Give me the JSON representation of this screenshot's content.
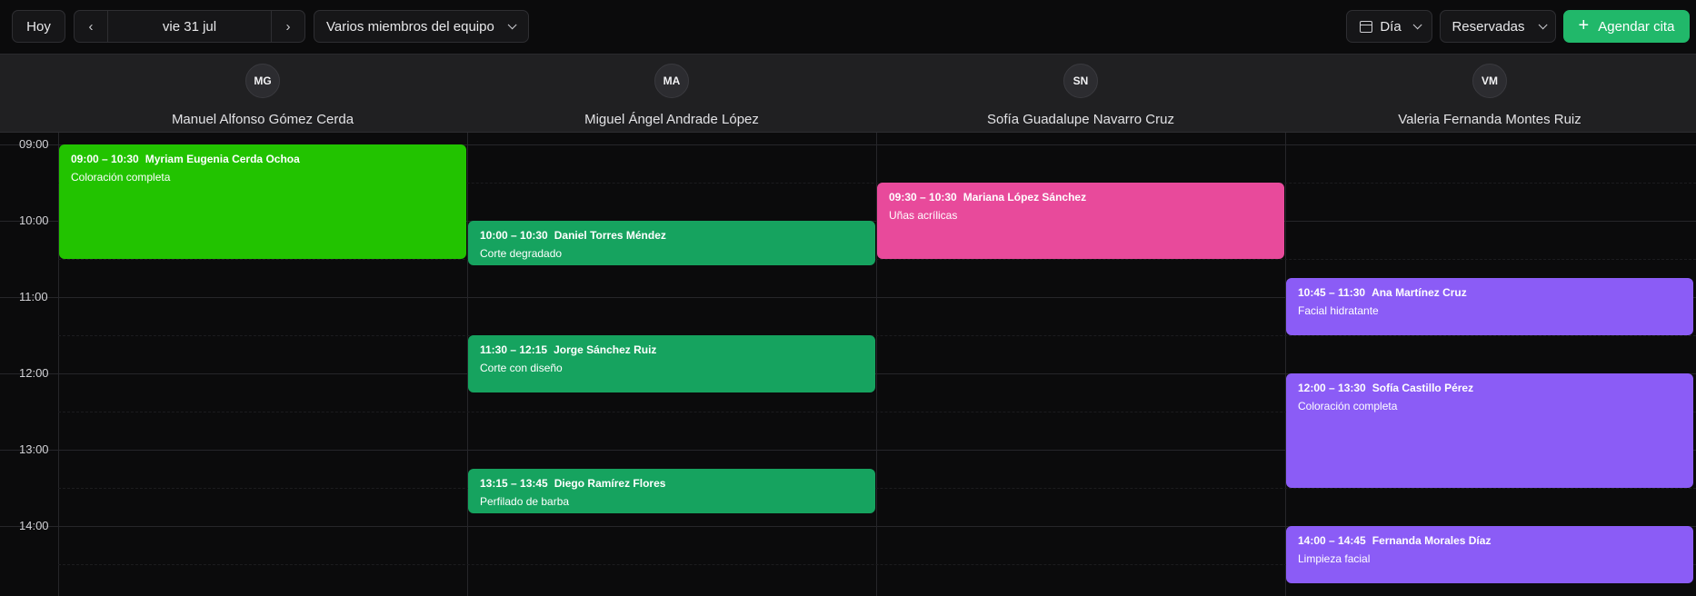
{
  "toolbar": {
    "today_label": "Hoy",
    "prev_icon": "chevron-left-icon",
    "next_icon": "chevron-right-icon",
    "date_label": "vie 31 jul",
    "team_label": "Varios miembros del equipo",
    "view_label": "Día",
    "filter_label": "Reservadas",
    "add_label": "Agendar cita",
    "accent_color": "#21b86a"
  },
  "staff": [
    {
      "initials": "MG",
      "name": "Manuel Alfonso Gómez Cerda"
    },
    {
      "initials": "MA",
      "name": "Miguel Ángel Andrade López"
    },
    {
      "initials": "SN",
      "name": "Sofía Guadalupe Navarro Cruz"
    },
    {
      "initials": "VM",
      "name": "Valeria Fernanda Montes Ruiz"
    }
  ],
  "hours": [
    "09:00",
    "10:00",
    "11:00",
    "12:00",
    "13:00",
    "14:00"
  ],
  "appointments": [
    {
      "staff_index": 0,
      "start": "09:00",
      "end": "10:30",
      "time": "09:00 – 10:30",
      "client": "Myriam Eugenia Cerda Ochoa",
      "service": "Coloración completa",
      "color": "#22c300"
    },
    {
      "staff_index": 1,
      "start": "10:00",
      "end": "10:35",
      "time": "10:00 – 10:30",
      "client": "Daniel Torres Méndez",
      "service": "Corte degradado",
      "color": "#16a35f"
    },
    {
      "staff_index": 1,
      "start": "11:30",
      "end": "12:15",
      "time": "11:30 – 12:15",
      "client": "Jorge Sánchez Ruiz",
      "service": "Corte con diseño",
      "color": "#16a35f"
    },
    {
      "staff_index": 1,
      "start": "13:15",
      "end": "13:50",
      "time": "13:15 – 13:45",
      "client": "Diego Ramírez Flores",
      "service": "Perfilado de barba",
      "color": "#16a35f"
    },
    {
      "staff_index": 2,
      "start": "09:30",
      "end": "10:30",
      "time": "09:30 – 10:30",
      "client": "Mariana López Sánchez",
      "service": "Uñas acrílicas",
      "color": "#e84a9b"
    },
    {
      "staff_index": 3,
      "start": "10:45",
      "end": "11:30",
      "time": "10:45 – 11:30",
      "client": "Ana Martínez Cruz",
      "service": "Facial hidratante",
      "color": "#8b5cf6"
    },
    {
      "staff_index": 3,
      "start": "12:00",
      "end": "13:30",
      "time": "12:00 – 13:30",
      "client": "Sofía Castillo Pérez",
      "service": "Coloración completa",
      "color": "#8b5cf6"
    },
    {
      "staff_index": 3,
      "start": "14:00",
      "end": "14:45",
      "time": "14:00 – 14:45",
      "client": "Fernanda Morales Díaz",
      "service": "Limpieza facial",
      "color": "#8b5cf6"
    }
  ]
}
